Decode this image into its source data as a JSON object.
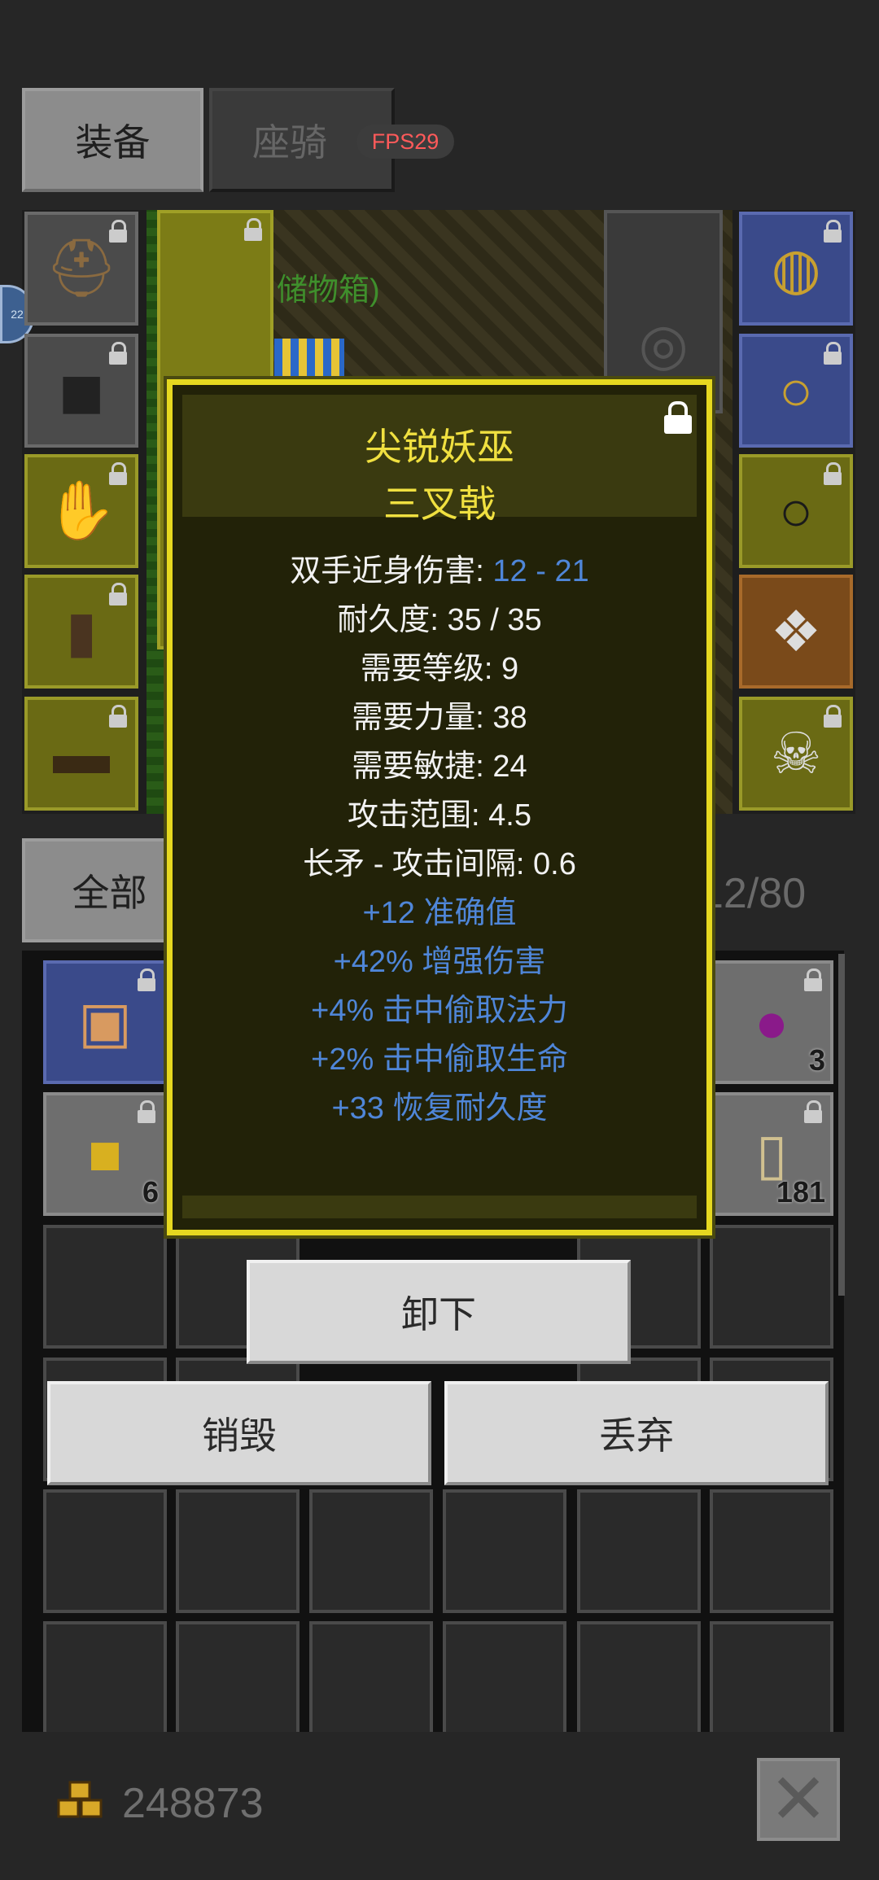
{
  "tabs": {
    "equipment": "装备",
    "mount": "座骑"
  },
  "fps": "FPS29",
  "side_badge": "22",
  "storage_label": "储物箱)",
  "bag": {
    "filter_tab": "全部",
    "capacity": "12/80",
    "items": [
      {
        "count": "3"
      },
      {
        "count": "6"
      },
      {
        "count": "181"
      }
    ]
  },
  "popup": {
    "name": "尖锐妖巫",
    "type": "三叉戟",
    "stats": {
      "damage_label": "双手近身伤害: ",
      "damage_value": "12 - 21",
      "durability": "耐久度: 35 / 35",
      "req_level": "需要等级: 9",
      "req_str": "需要力量: 38",
      "req_agi": "需要敏捷: 24",
      "range": "攻击范围: 4.5",
      "interval": "长矛 - 攻击间隔: 0.6"
    },
    "affixes": [
      "+12 准确值",
      "+42% 增强伤害",
      "+4% 击中偷取法力",
      "+2% 击中偷取生命",
      "+33 恢复耐久度"
    ]
  },
  "actions": {
    "unequip": "卸下",
    "destroy": "销毁",
    "discard": "丢弃"
  },
  "gold": "248873",
  "close_icon": "close-x-icon"
}
